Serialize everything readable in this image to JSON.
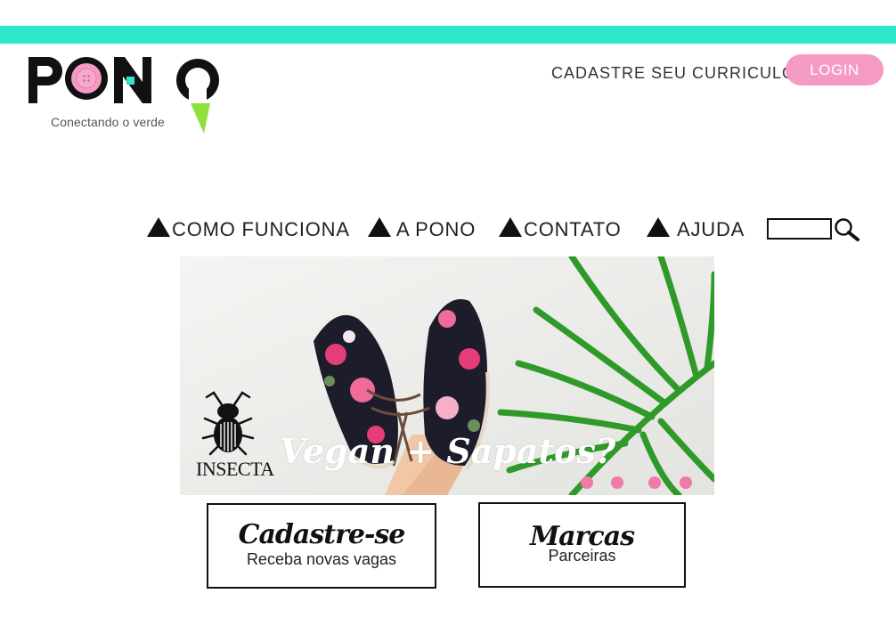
{
  "brand": {
    "name": "PONO",
    "tagline": "Conectando o verde",
    "accent_color": "#2ee6c9",
    "pink_color": "#f59ac3"
  },
  "header": {
    "register_link": "CADASTRE SEU CURRICULO",
    "login_label": "LOGIN"
  },
  "nav": {
    "items": [
      {
        "label": "COMO FUNCIONA",
        "icon": "triangle-icon"
      },
      {
        "label": "A PONO",
        "icon": "triangle-icon"
      },
      {
        "label": "CONTATO",
        "icon": "triangle-icon"
      },
      {
        "label": "AJUDA",
        "icon": "triangle-icon"
      }
    ],
    "search_icon": "search-icon"
  },
  "banner": {
    "brand": "INSECTA",
    "headline": "Vegan + Sapatos?",
    "slide_count": 4
  },
  "cards": [
    {
      "title": "Cadastre-se",
      "subtitle": "Receba novas vagas"
    },
    {
      "title": "Marcas",
      "subtitle": "Parceiras"
    }
  ]
}
